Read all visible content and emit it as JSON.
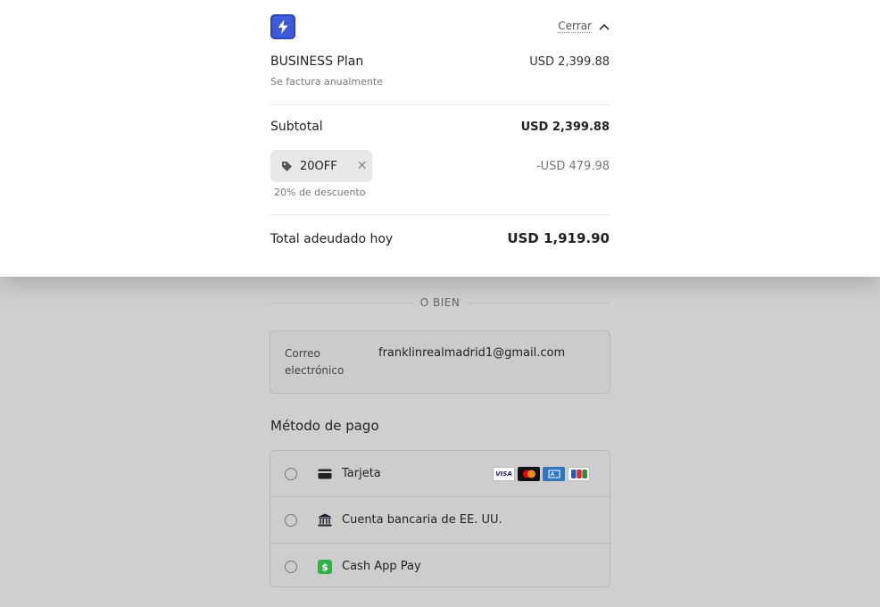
{
  "header": {
    "close_label": "Cerrar"
  },
  "summary": {
    "plan_name": "BUSINESS Plan",
    "plan_price": "USD 2,399.88",
    "plan_billing": "Se factura anualmente",
    "subtotal_label": "Subtotal",
    "subtotal_value": "USD 2,399.88",
    "coupon_code": "20OFF",
    "discount_value": "-USD 479.98",
    "discount_note": "20% de descuento",
    "total_label": "Total adeudado hoy",
    "total_value": "USD 1,919.90"
  },
  "divider_text": "O BIEN",
  "email": {
    "label": "Correo electrónico",
    "value": "franklinrealmadrid1@gmail.com"
  },
  "payment": {
    "title": "Método de pago",
    "methods": [
      {
        "label": "Tarjeta",
        "icon": "card-icon"
      },
      {
        "label": "Cuenta bancaria de EE. UU.",
        "icon": "bank-icon"
      },
      {
        "label": "Cash App Pay",
        "icon": "cash-app-icon"
      }
    ],
    "card_brands": [
      "VISA",
      "mastercard",
      "amex",
      "jcb"
    ]
  },
  "colors": {
    "brand_logo": "#3d5bd9",
    "cash_app": "#2fb14a",
    "overlay": "#cfcfcf"
  }
}
